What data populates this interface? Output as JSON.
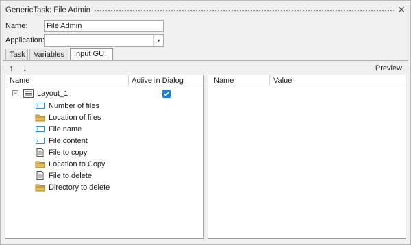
{
  "window": {
    "title": "GenericTask: File Admin",
    "close_icon": "close-icon"
  },
  "form": {
    "name_label": "Name:",
    "name_value": "File Admin",
    "application_label": "Application:",
    "application_value": ""
  },
  "tabs": [
    {
      "label": "Task",
      "active": false
    },
    {
      "label": "Variables",
      "active": false
    },
    {
      "label": "Input GUI",
      "active": true
    }
  ],
  "toolbar": {
    "move_up_icon": "arrow-up-icon",
    "move_down_icon": "arrow-down-icon",
    "preview_label": "Preview"
  },
  "left_table": {
    "columns": [
      "Name",
      "Active in Dialog"
    ],
    "root": {
      "label": "Layout_1",
      "expanded": true,
      "active": true,
      "icon": "layout-icon"
    },
    "items": [
      {
        "label": "Number of files",
        "icon": "textfield-icon"
      },
      {
        "label": "Location of files",
        "icon": "folder-icon"
      },
      {
        "label": "File name",
        "icon": "textfield-icon"
      },
      {
        "label": "File content",
        "icon": "textfield-icon"
      },
      {
        "label": "File to copy",
        "icon": "file-icon"
      },
      {
        "label": "Location to Copy",
        "icon": "folder-icon"
      },
      {
        "label": "File to delete",
        "icon": "file-icon"
      },
      {
        "label": "Directory to delete",
        "icon": "folder-icon"
      }
    ]
  },
  "right_table": {
    "columns": [
      "Name",
      "Value"
    ]
  },
  "colors": {
    "accent": "#1f7ed8",
    "folder": "#d8b04a"
  }
}
